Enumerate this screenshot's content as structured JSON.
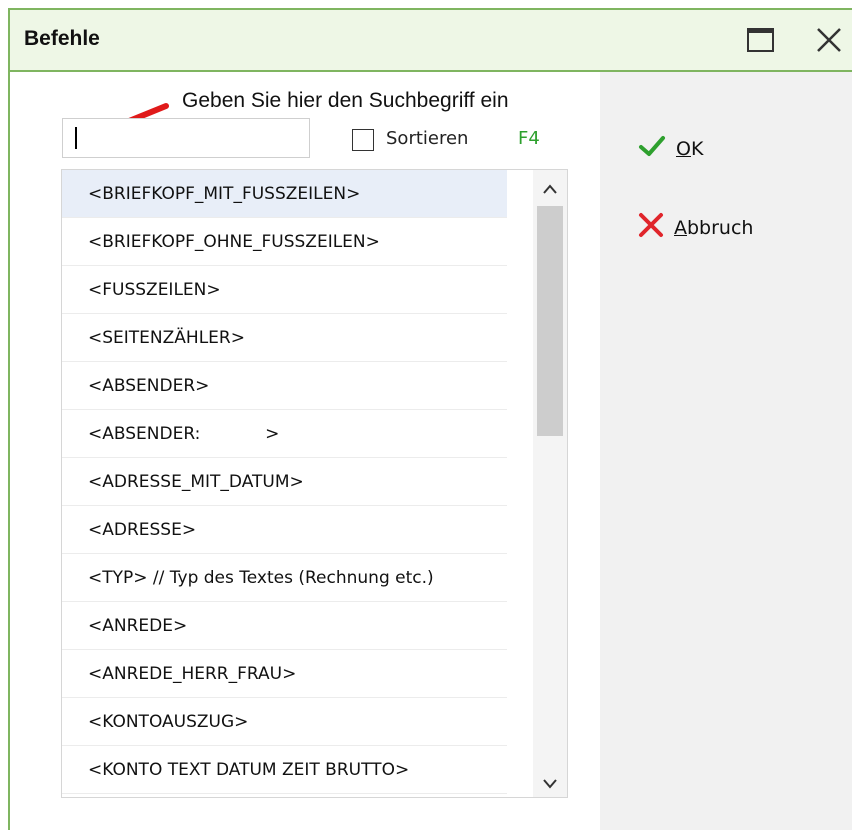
{
  "window": {
    "title": "Befehle"
  },
  "search": {
    "hint": "Geben Sie hier den Suchbegriff ein",
    "value": "",
    "placeholder": ""
  },
  "sort": {
    "label": "Sortieren",
    "checked": false,
    "shortcut": "F4"
  },
  "list": {
    "items": [
      "<BRIEFKOPF_MIT_FUSSZEILEN>",
      "<BRIEFKOPF_OHNE_FUSSZEILEN>",
      "<FUSSZEILEN>",
      "<SEITENZÄHLER>",
      "<ABSENDER>",
      "<ABSENDER:            >",
      "<ADRESSE_MIT_DATUM>",
      "<ADRESSE>",
      "<TYP> // Typ des Textes (Rechnung etc.)",
      "<ANREDE>",
      "<ANREDE_HERR_FRAU>",
      "<KONTOAUSZUG>",
      "<KONTO TEXT DATUM ZEIT BRUTTO>"
    ]
  },
  "buttons": {
    "ok": {
      "mnemonic": "O",
      "rest": "K"
    },
    "cancel": {
      "mnemonic": "A",
      "rest": "bbruch"
    }
  },
  "colors": {
    "accent": "#7fb560",
    "ok": "#2ea02e",
    "cancel": "#e0252b",
    "arrow": "#e01a1a"
  }
}
